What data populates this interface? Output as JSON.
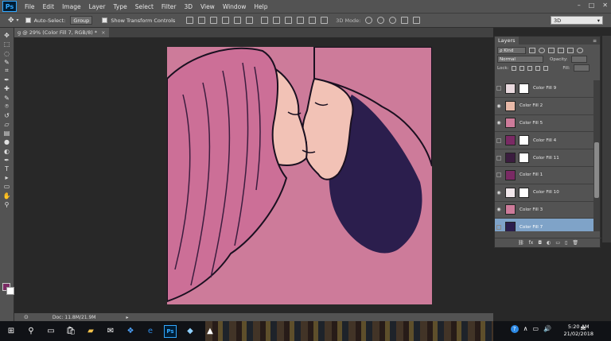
{
  "app": {
    "logo": "Ps",
    "menu": [
      "File",
      "Edit",
      "Image",
      "Layer",
      "Type",
      "Select",
      "Filter",
      "3D",
      "View",
      "Window",
      "Help"
    ],
    "window_controls": [
      "–",
      "□",
      "✕"
    ]
  },
  "options_bar": {
    "tool_icon": "move-icon",
    "auto_select_label": "Auto-Select:",
    "auto_select_target": "Group",
    "transform_label": "Show Transform Controls",
    "mode_3d_label": "3D Mode:",
    "workspace": "3D"
  },
  "document": {
    "tab_title": "g @ 29% (Color Fill 7, RGB/8) *",
    "tab_close": "×",
    "status_text": "Doc: 11.8M/21.9M",
    "artwork_bg": "#cd7b9a"
  },
  "toolbar": {
    "tools": [
      "move-icon",
      "marquee-icon",
      "lasso-icon",
      "quick-select-icon",
      "crop-icon",
      "eyedropper-icon",
      "healing-icon",
      "brush-icon",
      "stamp-icon",
      "history-brush-icon",
      "eraser-icon",
      "gradient-icon",
      "blur-icon",
      "dodge-icon",
      "pen-icon",
      "type-icon",
      "path-select-icon",
      "shape-icon",
      "hand-icon",
      "zoom-icon"
    ],
    "glyphs": [
      "✥",
      "⬚",
      "◌",
      "✎",
      "⌗",
      "✒",
      "✚",
      "✎",
      "⍟",
      "↺",
      "▱",
      "▤",
      "●",
      "◐",
      "✒",
      "T",
      "▸",
      "▭",
      "✋",
      "⚲"
    ],
    "foreground_color": "#7a2a64",
    "background_color": "#ffffff"
  },
  "layers_panel": {
    "tab": "Layers",
    "filter_label": "ρ Kind",
    "blend_mode": "Normal",
    "opacity_label": "Opacity:",
    "lock_label": "Lock:",
    "fill_label": "Fill:",
    "layers": [
      {
        "name": "Color Fill 9",
        "visible": false,
        "mask": true,
        "thumb": "#e9d9de",
        "selected": false
      },
      {
        "name": "Color Fill 2",
        "visible": true,
        "mask": false,
        "thumb": "#e8b9a8",
        "selected": false
      },
      {
        "name": "Color Fill 5",
        "visible": true,
        "mask": false,
        "thumb": "#cd7b9a",
        "selected": false
      },
      {
        "name": "Color Fill 4",
        "visible": false,
        "mask": true,
        "thumb": "#7a2a64",
        "selected": false
      },
      {
        "name": "Color Fill 11",
        "visible": false,
        "mask": true,
        "thumb": "#3b1d3f",
        "selected": false
      },
      {
        "name": "Color Fill 1",
        "visible": false,
        "mask": false,
        "thumb": "#7a2a64",
        "selected": false
      },
      {
        "name": "Color Fill 10",
        "visible": true,
        "mask": true,
        "thumb": "#f0e6ea",
        "selected": false
      },
      {
        "name": "Color Fill 3",
        "visible": true,
        "mask": false,
        "thumb": "#cd7b9a",
        "selected": false
      },
      {
        "name": "Color Fill 7",
        "visible": false,
        "mask": false,
        "thumb": "#2b1e4d",
        "selected": true
      }
    ],
    "bottom_icons": [
      "⛓",
      "fx",
      "◘",
      "◐",
      "▭",
      "▯",
      "🗑"
    ]
  },
  "taskbar": {
    "start": "⊞",
    "items": [
      {
        "name": "search-icon",
        "glyph": "⚲",
        "color": "#ffffff"
      },
      {
        "name": "task-view-icon",
        "glyph": "▭",
        "color": "#ffffff"
      },
      {
        "name": "store-icon",
        "glyph": "🛍",
        "color": "#ffffff"
      },
      {
        "name": "explorer-icon",
        "glyph": "▰",
        "color": "#f4c24b"
      },
      {
        "name": "mail-icon",
        "glyph": "✉",
        "color": "#ffffff"
      },
      {
        "name": "dropbox-icon",
        "glyph": "❖",
        "color": "#4ea4ff"
      },
      {
        "name": "edge-icon",
        "glyph": "e",
        "color": "#2d8ae6"
      },
      {
        "name": "photoshop-icon",
        "glyph": "Ps",
        "color": "#31a8ff"
      },
      {
        "name": "app-icon",
        "glyph": "◆",
        "color": "#8fd1ff"
      },
      {
        "name": "photos-icon",
        "glyph": "▲",
        "color": "#ffffff"
      }
    ],
    "tray": [
      "?",
      "∧",
      "▭",
      "🔊",
      "✉"
    ],
    "time": "5:20 AM",
    "date": "21/02/2018"
  }
}
